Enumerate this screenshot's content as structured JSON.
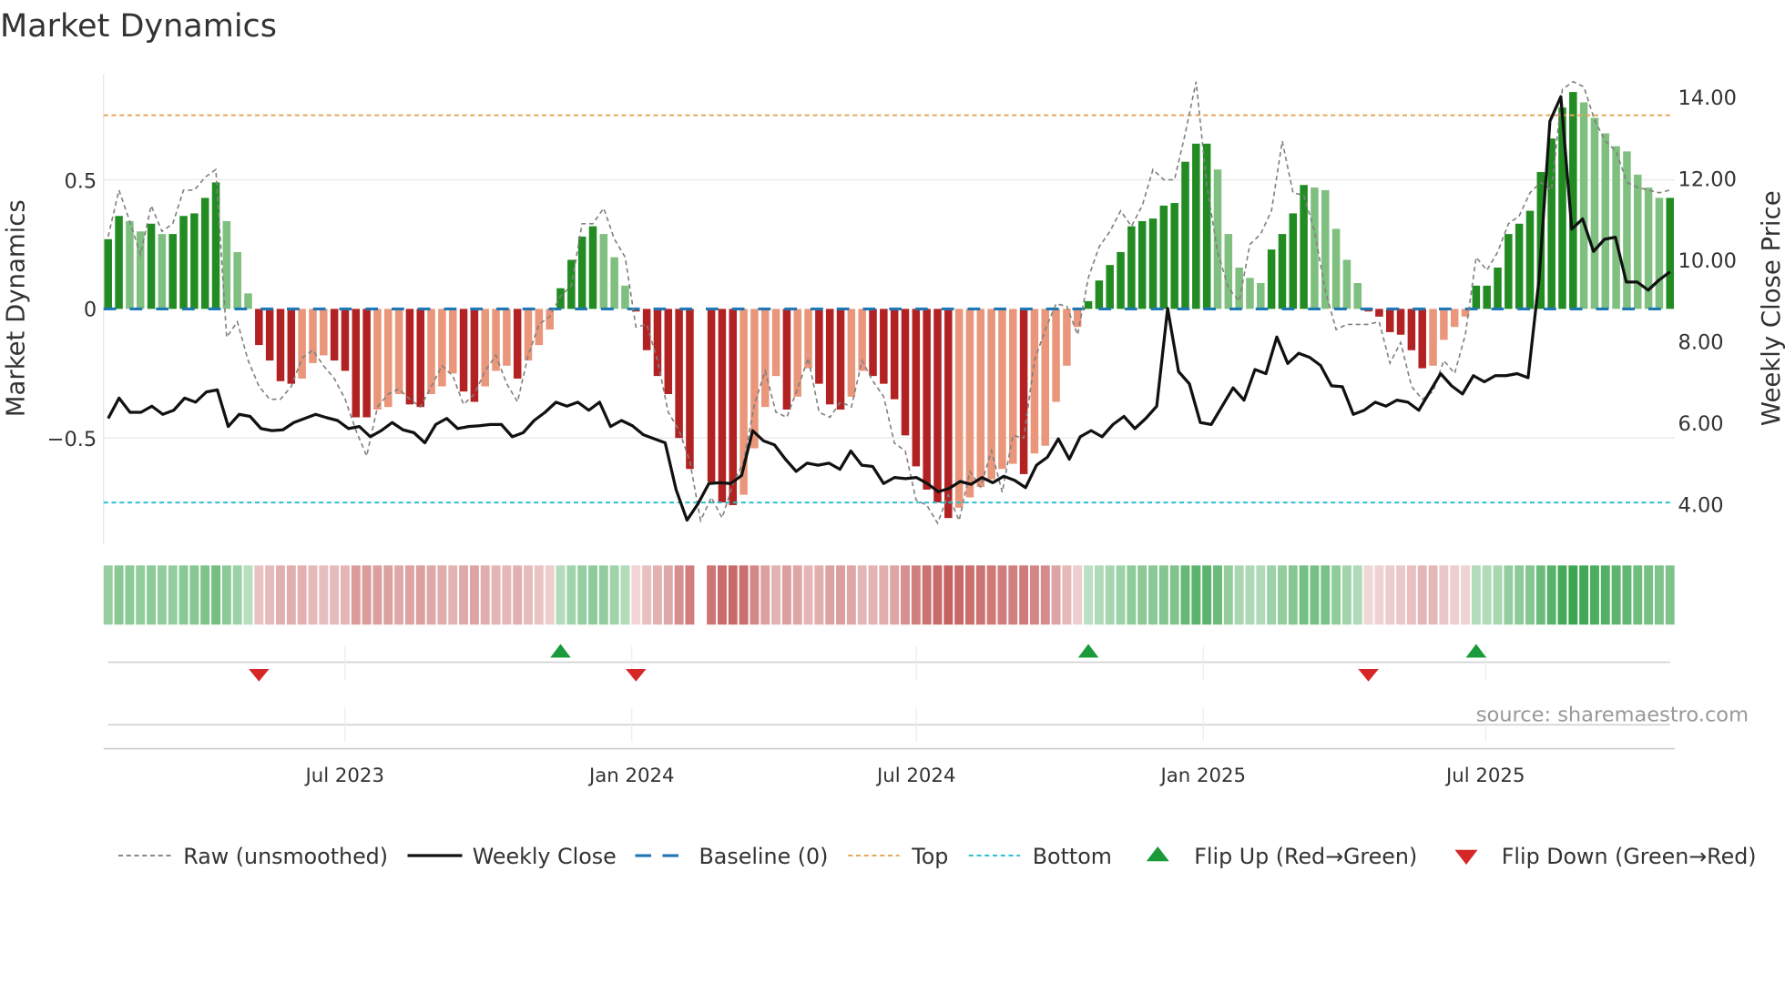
{
  "chart_data": {
    "type": "bar",
    "title": "Market Dynamics",
    "ylabel": "Market Dynamics",
    "y2label": "Weekly Close Price",
    "ylim": [
      -0.91,
      0.91
    ],
    "y2lim": [
      3.02,
      14.56
    ],
    "yticks": [
      "0.5",
      "0",
      "−0.5"
    ],
    "ytick_values": [
      0.5,
      0,
      -0.5
    ],
    "y2ticks": [
      "14.00",
      "12.00",
      "10.00",
      "8.00",
      "6.00",
      "4.00"
    ],
    "y2tick_values": [
      14,
      12,
      10,
      8,
      6,
      4
    ],
    "xticks": [
      "Jul 2023",
      "Jan 2024",
      "Jul 2024",
      "Jan 2025",
      "Jul 2025"
    ],
    "top_level": 0.75,
    "bottom_level": -0.75,
    "baseline": 0,
    "values": [
      0.27,
      0.36,
      0.34,
      0.3,
      0.33,
      0.29,
      0.29,
      0.36,
      0.37,
      0.43,
      0.49,
      0.34,
      0.22,
      0.06,
      -0.14,
      -0.2,
      -0.28,
      -0.29,
      -0.27,
      -0.21,
      -0.18,
      -0.2,
      -0.24,
      -0.42,
      -0.42,
      -0.39,
      -0.38,
      -0.33,
      -0.37,
      -0.38,
      -0.33,
      -0.3,
      -0.25,
      -0.32,
      -0.36,
      -0.3,
      -0.24,
      -0.22,
      -0.27,
      -0.2,
      -0.14,
      -0.08,
      0.08,
      0.19,
      0.28,
      0.32,
      0.29,
      0.2,
      0.09,
      -0.01,
      -0.16,
      -0.26,
      -0.33,
      -0.5,
      -0.62,
      null,
      -0.67,
      -0.75,
      -0.76,
      -0.72,
      -0.54,
      -0.38,
      -0.26,
      -0.39,
      -0.34,
      -0.23,
      -0.29,
      -0.37,
      -0.39,
      -0.34,
      -0.24,
      -0.26,
      -0.29,
      -0.35,
      -0.49,
      -0.61,
      -0.7,
      -0.75,
      -0.81,
      -0.77,
      -0.73,
      -0.69,
      -0.66,
      -0.62,
      -0.6,
      -0.64,
      -0.56,
      -0.53,
      -0.36,
      -0.22,
      -0.07,
      0.03,
      0.11,
      0.17,
      0.22,
      0.32,
      0.34,
      0.35,
      0.4,
      0.41,
      0.57,
      0.64,
      0.64,
      0.54,
      0.29,
      0.16,
      0.12,
      0.1,
      0.23,
      0.29,
      0.37,
      0.48,
      0.47,
      0.46,
      0.31,
      0.19,
      0.1,
      -0.01,
      -0.03,
      -0.09,
      -0.1,
      -0.16,
      -0.23,
      -0.22,
      -0.12,
      -0.07,
      -0.03,
      0.09,
      0.09,
      0.16,
      0.29,
      0.33,
      0.38,
      0.53,
      0.66,
      0.78,
      0.84,
      0.8,
      0.74,
      0.68,
      0.63,
      0.61,
      0.52,
      0.47,
      0.43,
      0.43
    ],
    "raw": [
      0.28,
      0.46,
      0.34,
      0.21,
      0.4,
      0.3,
      0.33,
      0.46,
      0.46,
      0.51,
      0.54,
      -0.11,
      -0.05,
      -0.2,
      -0.3,
      -0.35,
      -0.35,
      -0.3,
      -0.19,
      -0.16,
      -0.22,
      -0.27,
      -0.35,
      -0.47,
      -0.57,
      -0.38,
      -0.33,
      -0.31,
      -0.35,
      -0.38,
      -0.3,
      -0.22,
      -0.26,
      -0.37,
      -0.33,
      -0.24,
      -0.18,
      -0.29,
      -0.36,
      -0.18,
      -0.06,
      -0.03,
      0.05,
      0.09,
      0.33,
      0.33,
      0.39,
      0.27,
      0.2,
      -0.07,
      -0.06,
      -0.2,
      -0.4,
      -0.47,
      -0.59,
      -0.82,
      -0.73,
      -0.81,
      -0.68,
      -0.59,
      -0.37,
      -0.24,
      -0.4,
      -0.42,
      -0.31,
      -0.19,
      -0.4,
      -0.42,
      -0.36,
      -0.38,
      -0.2,
      -0.28,
      -0.34,
      -0.52,
      -0.55,
      -0.74,
      -0.76,
      -0.83,
      -0.72,
      -0.82,
      -0.63,
      -0.69,
      -0.55,
      -0.71,
      -0.49,
      -0.5,
      -0.2,
      -0.08,
      0.02,
      0.01,
      -0.1,
      0.12,
      0.24,
      0.3,
      0.38,
      0.32,
      0.4,
      0.54,
      0.5,
      0.5,
      0.68,
      0.88,
      0.48,
      0.22,
      0.08,
      0.03,
      0.25,
      0.29,
      0.38,
      0.65,
      0.45,
      0.44,
      0.3,
      0.07,
      -0.08,
      -0.06,
      -0.06,
      -0.06,
      -0.05,
      -0.21,
      -0.13,
      -0.3,
      -0.35,
      -0.32,
      -0.2,
      -0.25,
      -0.1,
      0.2,
      0.15,
      0.22,
      0.33,
      0.36,
      0.45,
      0.49,
      0.46,
      0.85,
      0.88,
      0.86,
      0.73,
      0.65,
      0.61,
      0.49,
      0.47,
      0.46,
      0.45,
      0.46
    ],
    "weekly_close": [
      6.1,
      6.6,
      6.25,
      6.25,
      6.4,
      6.2,
      6.3,
      6.6,
      6.5,
      6.75,
      6.8,
      5.9,
      6.2,
      6.15,
      5.85,
      5.8,
      5.82,
      6.0,
      6.1,
      6.2,
      6.12,
      6.05,
      5.85,
      5.9,
      5.65,
      5.8,
      6.0,
      5.82,
      5.75,
      5.5,
      5.95,
      6.1,
      5.85,
      5.9,
      5.92,
      5.95,
      5.95,
      5.65,
      5.75,
      6.05,
      6.25,
      6.5,
      6.4,
      6.5,
      6.3,
      6.5,
      5.9,
      6.05,
      5.92,
      5.7,
      5.6,
      5.5,
      4.35,
      3.6,
      4.0,
      4.5,
      4.52,
      4.5,
      4.7,
      5.8,
      5.55,
      5.45,
      5.1,
      4.8,
      5.0,
      4.95,
      5.0,
      4.85,
      5.3,
      4.95,
      4.92,
      4.5,
      4.65,
      4.62,
      4.65,
      4.5,
      4.3,
      4.38,
      4.55,
      4.48,
      4.65,
      4.52,
      4.68,
      4.58,
      4.4,
      4.95,
      5.15,
      5.6,
      5.1,
      5.65,
      5.8,
      5.65,
      5.95,
      6.15,
      5.85,
      6.1,
      6.4,
      8.8,
      7.25,
      6.95,
      6.0,
      5.95,
      6.4,
      6.85,
      6.55,
      7.3,
      7.2,
      8.1,
      7.45,
      7.7,
      7.6,
      7.4,
      6.9,
      6.88,
      6.2,
      6.3,
      6.5,
      6.4,
      6.55,
      6.5,
      6.3,
      6.75,
      7.2,
      6.9,
      6.7,
      7.15,
      7.0,
      7.15,
      7.15,
      7.2,
      7.1,
      9.5,
      13.4,
      14.0,
      10.75,
      11.0,
      10.2,
      10.5,
      10.55,
      9.45,
      9.45,
      9.25,
      9.5,
      9.7
    ],
    "flips": [
      {
        "type": "down",
        "week_index": 14
      },
      {
        "type": "up",
        "week_index": 42
      },
      {
        "type": "down",
        "week_index": 49
      },
      {
        "type": "up",
        "week_index": 91
      },
      {
        "type": "down",
        "week_index": 117
      },
      {
        "type": "up",
        "week_index": 127
      }
    ],
    "legend": {
      "placement": "bottom",
      "items": [
        "Raw (unsmoothed)",
        "Weekly Close",
        "Baseline (0)",
        "Top",
        "Bottom",
        "Flip Up (Red→Green)",
        "Flip Down (Green→Red)"
      ]
    },
    "colors": {
      "green_rising": "#228b22",
      "green_falling": "#7fbf7f",
      "red_falling": "#b22222",
      "red_rising": "#e9967a",
      "raw": "#808080",
      "close": "#111111",
      "baseline": "#1f77b4",
      "top": "#e8a65a",
      "bottom": "#2bc0d0",
      "flip_up": "#1a9a3a",
      "flip_down": "#d62728"
    }
  },
  "source": "source: sharemaestro.com"
}
